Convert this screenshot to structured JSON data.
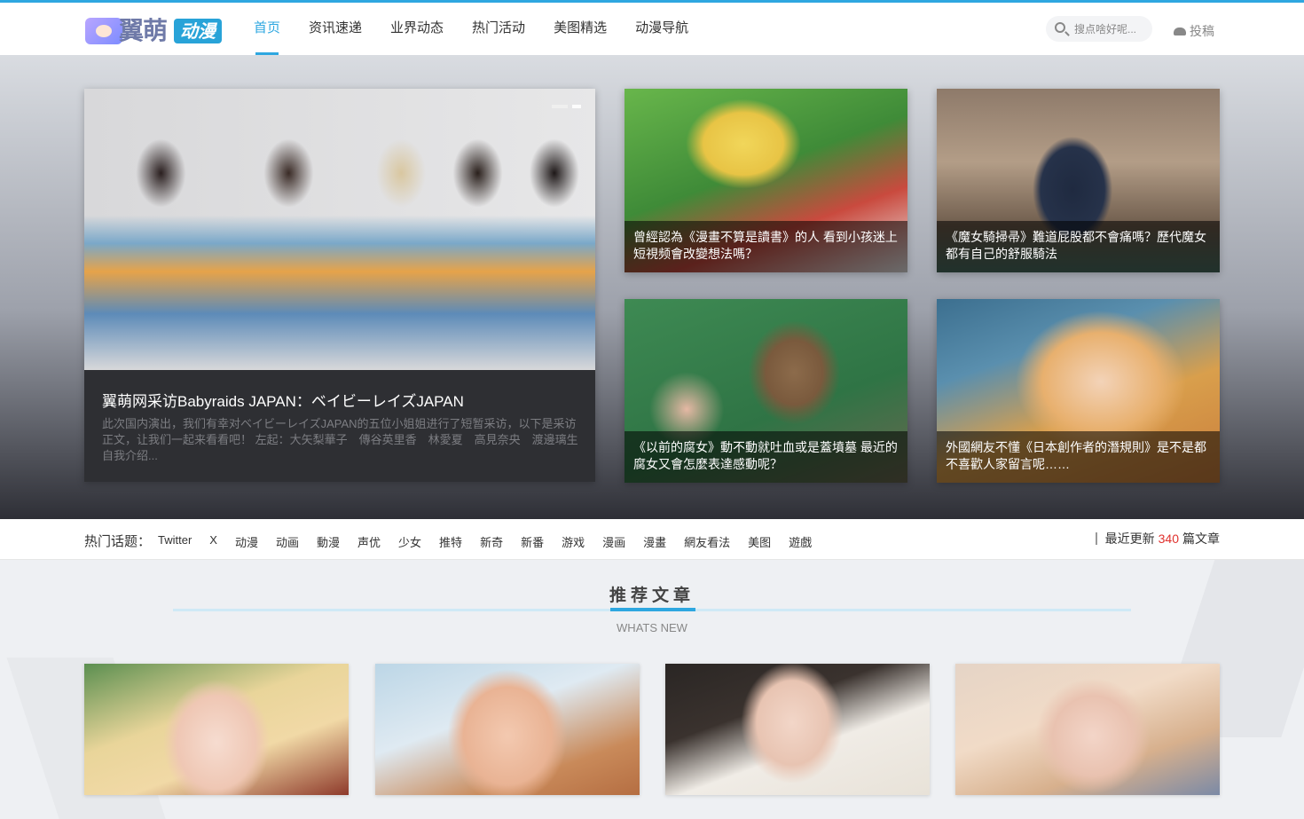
{
  "header": {
    "logo_text_1": "翼萌",
    "logo_text_2": "动漫",
    "nav": [
      "首页",
      "资讯速递",
      "业界动态",
      "热门活动",
      "美图精选",
      "动漫导航"
    ],
    "active_nav": "首页",
    "search_placeholder": "搜点啥好呢...",
    "submit_label": "投稿",
    "accent_color": "#2ea7e0"
  },
  "hero": {
    "main": {
      "title": "翼萌网采访Babyraids JAPAN：ベイビーレイズJAPAN",
      "description": "此次国内演出，我们有幸对ベイビーレイズJAPAN的五位小姐姐进行了短暂采访，以下是采访正文，让我们一起来看看吧！ 左起：大矢梨華子　傳谷英里香　林愛夏　高見奈央　渡邊璃生 自我介绍..."
    },
    "cards": [
      {
        "title": "曾經認為《漫畫不算是讀書》的人 看到小孩迷上短視频會改變想法嗎？"
      },
      {
        "title": "《魔女騎掃帚》難道屁股都不會痛嗎？歷代魔女都有自己的舒服騎法"
      },
      {
        "title": "《以前的腐女》動不動就吐血或是蓋墳墓 最近的腐女又會怎麼表達感動呢？"
      },
      {
        "title": "外國網友不懂《日本創作者的潛規則》是不是都不喜歡人家留言呢……"
      }
    ]
  },
  "topics": {
    "label": "热门话题：",
    "tags": [
      "Twitter",
      "X",
      "动漫",
      "动画",
      "動漫",
      "声优",
      "少女",
      "推特",
      "新奇",
      "新番",
      "游戏",
      "漫画",
      "漫畫",
      "網友看法",
      "美图",
      "遊戲"
    ],
    "recent_prefix": "最近更新",
    "recent_count": "340",
    "recent_suffix": "篇文章",
    "count_color": "#e0322e"
  },
  "recommended": {
    "title": "推荐文章",
    "subtitle": "WHATS NEW"
  }
}
